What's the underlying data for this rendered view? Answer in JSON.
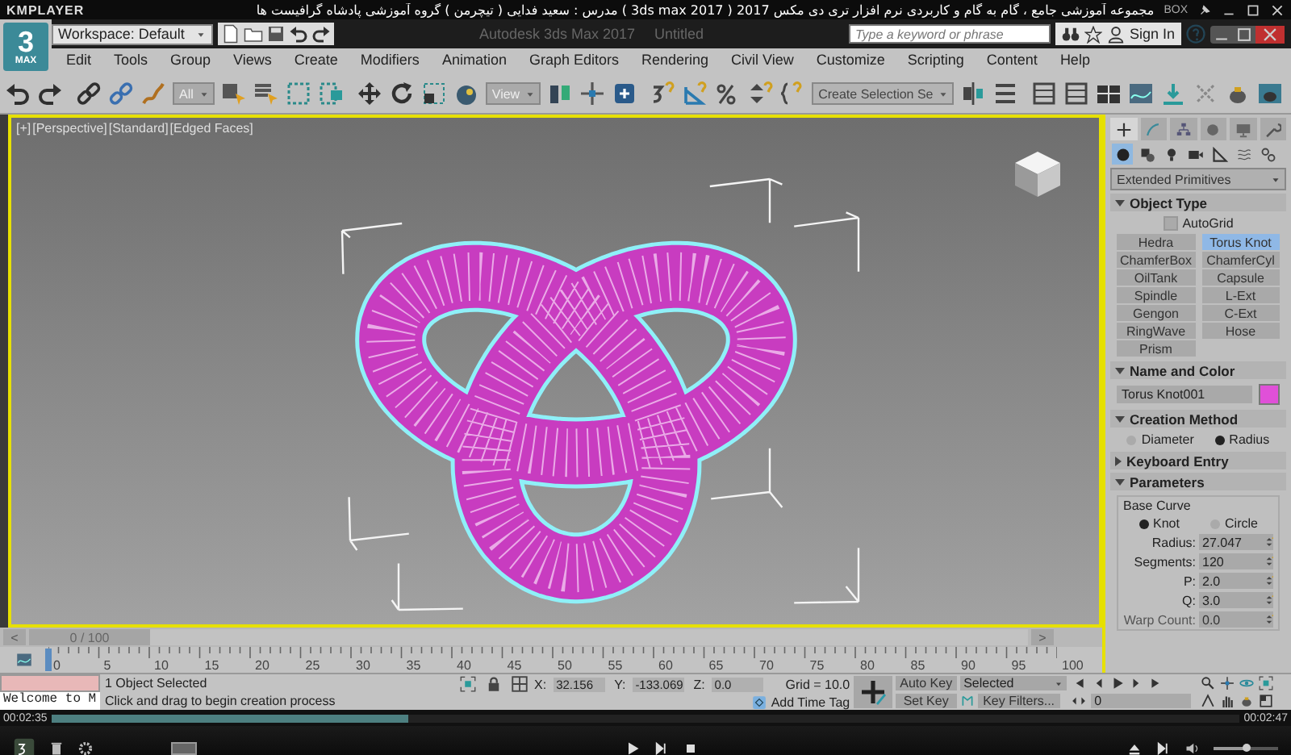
{
  "player": {
    "brand": "KMPLAYER",
    "title": "مجموعه آموزشی جامع ، گام به گام و کاربردی نرم افزار تری دی مکس 2017 ( 3ds max 2017 )  مدرس : سعید فدایی ( تیچرمن ) گروه آموزشی پادشاه گرافیست ها",
    "box_label": "BOX",
    "elapsed": "00:02:35",
    "total": "00:02:47",
    "progress": {
      "level": 0.3
    },
    "volume": {
      "level": 0.5
    }
  },
  "app": {
    "logo": "3",
    "logo_sub": "MAX",
    "workspace": "Workspace: Default",
    "title": "Autodesk 3ds Max 2017",
    "document": "Untitled",
    "search": {
      "placeholder": "Type a keyword or phrase"
    },
    "sign_in": "Sign In"
  },
  "menu": [
    "Edit",
    "Tools",
    "Group",
    "Views",
    "Create",
    "Modifiers",
    "Animation",
    "Graph Editors",
    "Rendering",
    "Civil View",
    "Customize",
    "Scripting",
    "Content",
    "Help"
  ],
  "toolbar": {
    "selection_filter": "All",
    "reference_coord": "View",
    "named_selection": "Create Selection Se"
  },
  "viewport": {
    "labels": [
      "[+]",
      "[Perspective]",
      "[Standard]",
      "[Edged Faces]"
    ]
  },
  "command_panel": {
    "tabs": [
      {
        "kind": "create",
        "selected": true
      },
      {
        "kind": "modify",
        "selected": false
      },
      {
        "kind": "hierarchy",
        "selected": false
      },
      {
        "kind": "motion",
        "selected": false
      },
      {
        "kind": "display",
        "selected": false
      },
      {
        "kind": "utilities",
        "selected": false
      }
    ],
    "categories": [
      {
        "kind": "geometry",
        "selected": true
      },
      {
        "kind": "shapes",
        "selected": false
      },
      {
        "kind": "lights",
        "selected": false
      },
      {
        "kind": "cameras",
        "selected": false
      },
      {
        "kind": "helpers",
        "selected": false
      },
      {
        "kind": "spacewarps",
        "selected": false
      },
      {
        "kind": "systems",
        "selected": false
      }
    ],
    "type_dropdown": "Extended Primitives",
    "rollouts": [
      {
        "kind": "object_type",
        "title": "Object Type",
        "expanded": true,
        "autogrid": {
          "label": "AutoGrid",
          "checked": false
        },
        "buttons": [
          {
            "label": "Hedra",
            "selected": false
          },
          {
            "label": "Torus Knot",
            "selected": true
          },
          {
            "label": "ChamferBox",
            "selected": false
          },
          {
            "label": "ChamferCyl",
            "selected": false
          },
          {
            "label": "OilTank",
            "selected": false
          },
          {
            "label": "Capsule",
            "selected": false
          },
          {
            "label": "Spindle",
            "selected": false
          },
          {
            "label": "L-Ext",
            "selected": false
          },
          {
            "label": "Gengon",
            "selected": false
          },
          {
            "label": "C-Ext",
            "selected": false
          },
          {
            "label": "RingWave",
            "selected": false
          },
          {
            "label": "Hose",
            "selected": false
          },
          {
            "label": "Prism",
            "selected": false
          }
        ]
      },
      {
        "kind": "name_color",
        "title": "Name and Color",
        "expanded": true,
        "name": "Torus Knot001",
        "color": "#e050d8"
      },
      {
        "kind": "creation_method",
        "title": "Creation Method",
        "expanded": true,
        "options": [
          {
            "label": "Diameter",
            "selected": false
          },
          {
            "label": "Radius",
            "selected": true
          }
        ]
      },
      {
        "kind": "keyboard_entry",
        "title": "Keyboard Entry",
        "expanded": false
      },
      {
        "kind": "parameters",
        "title": "Parameters",
        "expanded": true,
        "group": "Base Curve",
        "options": [
          {
            "label": "Knot",
            "selected": true
          },
          {
            "label": "Circle",
            "selected": false
          }
        ],
        "spinners": [
          {
            "label": "Radius:",
            "value": "27.047",
            "disabled": false
          },
          {
            "label": "Segments:",
            "value": "120",
            "disabled": false
          },
          {
            "label": "P:",
            "value": "2.0",
            "disabled": false
          },
          {
            "label": "Q:",
            "value": "3.0",
            "disabled": false
          },
          {
            "label": "Warp Count:",
            "value": "0.0",
            "disabled": true
          }
        ]
      }
    ]
  },
  "timeline": {
    "prev_label": "<",
    "next_label": ">",
    "slider": {
      "label": "0 / 100",
      "level": 0
    },
    "ticks": [
      "0",
      "5",
      "10",
      "15",
      "20",
      "25",
      "30",
      "35",
      "40",
      "45",
      "50",
      "55",
      "60",
      "65",
      "70",
      "75",
      "80",
      "85",
      "90",
      "95",
      "100"
    ]
  },
  "status": {
    "prompt": "Welcome to M",
    "selection": "1 Object Selected",
    "hint": "Click and drag to begin creation process",
    "coords": [
      {
        "label": "X:",
        "value": "32.156"
      },
      {
        "label": "Y:",
        "value": "-133.069"
      },
      {
        "label": "Z:",
        "value": "0.0"
      }
    ],
    "grid": "Grid = 10.0",
    "time_tag": "Add Time Tag",
    "auto_key": "Auto Key",
    "key_mode": "Selected",
    "set_key": "Set Key",
    "key_filters": "Key Filters...",
    "frame": "0"
  }
}
